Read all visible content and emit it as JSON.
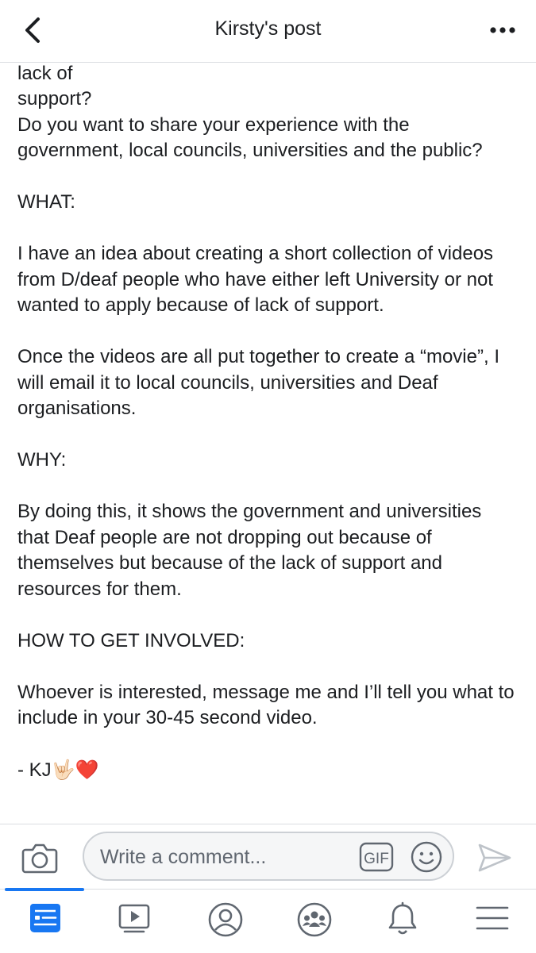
{
  "header": {
    "title": "Kirsty's post"
  },
  "post": {
    "paragraphs": [
      "support?\nDo you want to share your experience with the government, local councils, universities and the public?",
      "WHAT:",
      "I have an idea about creating a short collection of videos from D/deaf people who have either left University or not wanted to apply because of lack of support.",
      "Once the videos are all put together to create a “movie”, I will email it to local councils, universities and Deaf organisations.",
      "WHY:",
      "By doing this, it shows the government and universities that Deaf people are not dropping out because of themselves but because of the lack of support and resources for them.",
      "HOW TO GET INVOLVED:",
      "Whoever is interested, message me and I’ll tell you what to include in your 30-45 second video."
    ],
    "signoff": "- KJ",
    "signoff_emoji_1": "🤟🏻",
    "signoff_emoji_2": "❤️"
  },
  "comment_bar": {
    "placeholder": "Write a comment...",
    "gif_label": "GIF"
  },
  "tabs": [
    {
      "name": "news-feed",
      "icon": "news-feed-icon",
      "active": true
    },
    {
      "name": "watch",
      "icon": "video-icon",
      "active": false
    },
    {
      "name": "profile",
      "icon": "profile-icon",
      "active": false
    },
    {
      "name": "groups",
      "icon": "groups-icon",
      "active": false
    },
    {
      "name": "notifications",
      "icon": "bell-icon",
      "active": false
    },
    {
      "name": "menu",
      "icon": "hamburger-menu-icon",
      "active": false
    }
  ],
  "colors": {
    "accent": "#1877f2",
    "icon_gray": "#606770",
    "heart": "#e0243b"
  }
}
